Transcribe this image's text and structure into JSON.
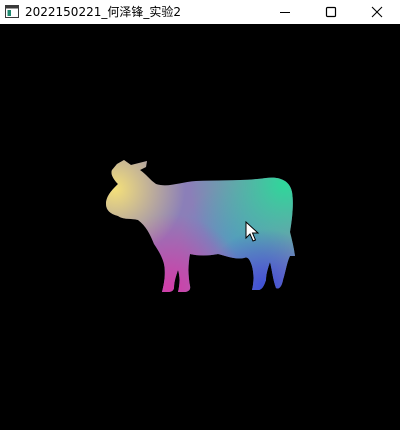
{
  "window": {
    "title": "2022150221_何泽锋_实验2",
    "background": "#000000"
  },
  "titlebar": {
    "app_icon": "window-app-icon",
    "buttons": [
      "minimize-icon",
      "maximize-icon",
      "close-icon"
    ]
  },
  "scene": {
    "object": "cow-silhouette",
    "fill_style": "vertex-color-gradient",
    "colors": {
      "head": "#f4e07a",
      "back": "#2fd79a",
      "belly": "#5e8fc4",
      "front_legs": "#d23ca8",
      "rear_legs": "#3a4fd6",
      "center": "#8b7fb8"
    }
  },
  "cursor": {
    "type": "arrow-cursor-icon"
  }
}
